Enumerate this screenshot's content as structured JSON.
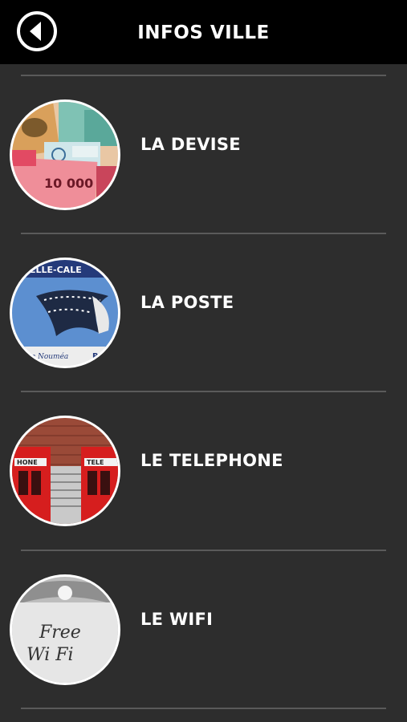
{
  "header": {
    "title": "INFOS VILLE"
  },
  "items": [
    {
      "label": "LA DEVISE",
      "icon": "currency-banknotes-image",
      "image_text": "10 000"
    },
    {
      "label": "LA POSTE",
      "icon": "postage-stamp-image",
      "image_text_top": "ELLE-CALE",
      "image_text_bottom": "de Nouméa",
      "image_text_right": "RE"
    },
    {
      "label": "LE TELEPHONE",
      "icon": "red-phone-booths-image",
      "image_text_left": "HONE",
      "image_text_right": "TELE"
    },
    {
      "label": "LE WIFI",
      "icon": "free-wifi-sign-image",
      "image_text_line1": "Free",
      "image_text_line2": "Wi Fi"
    }
  ]
}
